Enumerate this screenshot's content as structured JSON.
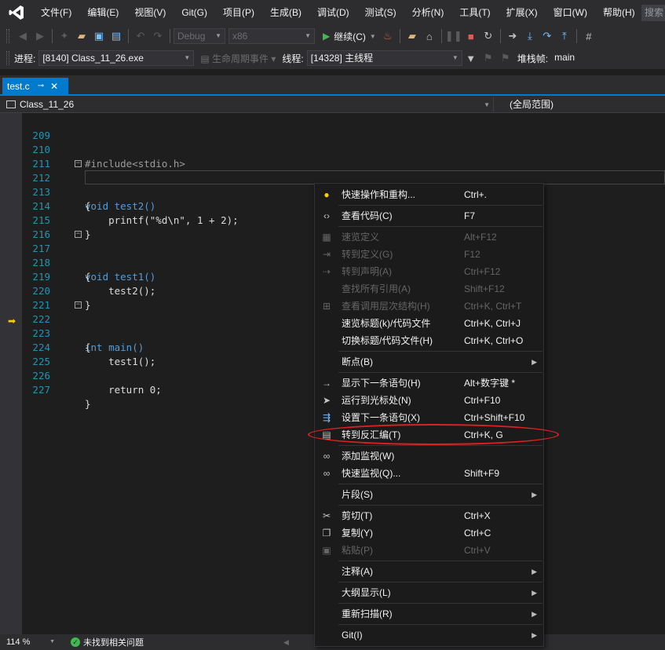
{
  "menubar": {
    "items": [
      "文件(F)",
      "编辑(E)",
      "视图(V)",
      "Git(G)",
      "项目(P)",
      "生成(B)",
      "调试(D)",
      "测试(S)",
      "分析(N)",
      "工具(T)",
      "扩展(X)",
      "窗口(W)",
      "帮助(H)"
    ],
    "search_placeholder": "搜索"
  },
  "toolbar": {
    "config": "Debug",
    "platform": "x86",
    "continue_label": "继续(C)"
  },
  "debug_toolbar": {
    "process_label": "进程:",
    "process_value": "[8140] Class_11_26.exe",
    "lifecycle_label": "生命周期事件",
    "thread_label": "线程:",
    "thread_value": "[14328] 主线程",
    "stackframe_label": "堆栈帧:",
    "stackframe_value": "main"
  },
  "tab": {
    "filename": "test.c"
  },
  "navbar": {
    "project": "Class_11_26",
    "scope": "(全局范围)"
  },
  "code": {
    "lines": [
      {
        "n": "209",
        "t": ""
      },
      {
        "n": "210",
        "t": "#include<stdio.h>"
      },
      {
        "n": "211",
        "t": ""
      },
      {
        "n": "212",
        "t": "void test2()"
      },
      {
        "n": "213",
        "t": "{"
      },
      {
        "n": "214",
        "t": "    printf(\"%d\\n\", 1 + 2);"
      },
      {
        "n": "215",
        "t": "}"
      },
      {
        "n": "216",
        "t": ""
      },
      {
        "n": "217",
        "t": "void test1()"
      },
      {
        "n": "218",
        "t": "{"
      },
      {
        "n": "219",
        "t": "    test2();"
      },
      {
        "n": "220",
        "t": "}"
      },
      {
        "n": "221",
        "t": ""
      },
      {
        "n": "222",
        "t": "int main()"
      },
      {
        "n": "223",
        "t": "{"
      },
      {
        "n": "224",
        "t": "    test1();"
      },
      {
        "n": "225",
        "t": ""
      },
      {
        "n": "226",
        "t": "    return 0;"
      },
      {
        "n": "227",
        "t": "}"
      }
    ]
  },
  "context_menu": {
    "items": [
      {
        "label": "快速操作和重构...",
        "shortcut": "Ctrl+.",
        "icon": "lightbulb-icon",
        "disabled": false
      },
      {
        "label": "查看代码(C)",
        "shortcut": "F7",
        "icon": "code-icon",
        "disabled": false
      },
      {
        "label": "速览定义",
        "shortcut": "Alt+F12",
        "icon": "peek-icon",
        "disabled": true
      },
      {
        "label": "转到定义(G)",
        "shortcut": "F12",
        "icon": "goto-def-icon",
        "disabled": true
      },
      {
        "label": "转到声明(A)",
        "shortcut": "Ctrl+F12",
        "icon": "goto-decl-icon",
        "disabled": true
      },
      {
        "label": "查找所有引用(A)",
        "shortcut": "Shift+F12",
        "icon": "",
        "disabled": true
      },
      {
        "label": "查看调用层次结构(H)",
        "shortcut": "Ctrl+K, Ctrl+T",
        "icon": "hierarchy-icon",
        "disabled": true
      },
      {
        "label": "速览标题(k)/代码文件",
        "shortcut": "Ctrl+K, Ctrl+J",
        "icon": "",
        "disabled": false
      },
      {
        "label": "切换标题/代码文件(H)",
        "shortcut": "Ctrl+K, Ctrl+O",
        "icon": "",
        "disabled": false
      },
      {
        "label": "断点(B)",
        "shortcut": "",
        "icon": "",
        "disabled": false,
        "submenu": true
      },
      {
        "label": "显示下一条语句(H)",
        "shortcut": "Alt+数字键 *",
        "icon": "arrow-right-icon",
        "disabled": false
      },
      {
        "label": "运行到光标处(N)",
        "shortcut": "Ctrl+F10",
        "icon": "cursor-icon",
        "disabled": false
      },
      {
        "label": "设置下一条语句(X)",
        "shortcut": "Ctrl+Shift+F10",
        "icon": "set-next-icon",
        "disabled": false
      },
      {
        "label": "转到反汇编(T)",
        "shortcut": "Ctrl+K, G",
        "icon": "disassembly-icon",
        "disabled": false
      },
      {
        "label": "添加监视(W)",
        "shortcut": "",
        "icon": "glasses-icon",
        "disabled": false
      },
      {
        "label": "快速监视(Q)...",
        "shortcut": "Shift+F9",
        "icon": "glasses-icon",
        "disabled": false
      },
      {
        "label": "片段(S)",
        "shortcut": "",
        "icon": "",
        "disabled": false,
        "submenu": true
      },
      {
        "label": "剪切(T)",
        "shortcut": "Ctrl+X",
        "icon": "scissors-icon",
        "disabled": false
      },
      {
        "label": "复制(Y)",
        "shortcut": "Ctrl+C",
        "icon": "copy-icon",
        "disabled": false
      },
      {
        "label": "粘贴(P)",
        "shortcut": "Ctrl+V",
        "icon": "paste-icon",
        "disabled": true
      },
      {
        "label": "注释(A)",
        "shortcut": "",
        "icon": "",
        "disabled": false,
        "submenu": true
      },
      {
        "label": "大纲显示(L)",
        "shortcut": "",
        "icon": "",
        "disabled": false,
        "submenu": true
      },
      {
        "label": "重新扫描(R)",
        "shortcut": "",
        "icon": "",
        "disabled": false,
        "submenu": true
      },
      {
        "label": "Git(I)",
        "shortcut": "",
        "icon": "",
        "disabled": false,
        "submenu": true
      }
    ]
  },
  "statusbar": {
    "zoom": "114 %",
    "issues": "未找到相关问题"
  },
  "colors": {
    "accent": "#007acc",
    "highlight_ring": "#e02020",
    "keyword": "#569cd6",
    "line_number": "#2b91af"
  }
}
